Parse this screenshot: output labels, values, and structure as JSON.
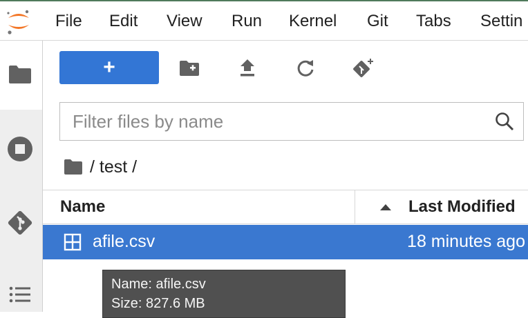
{
  "menubar": {
    "items": [
      "File",
      "Edit",
      "View",
      "Run",
      "Kernel",
      "Git",
      "Tabs",
      "Settin"
    ]
  },
  "sidebar": {
    "icons": [
      "folder-icon",
      "stop-circle-icon",
      "git-icon",
      "list-icon"
    ],
    "active": "folder-icon"
  },
  "toolbar": {
    "new_label": "+",
    "icons": [
      "new-folder-icon",
      "upload-icon",
      "refresh-icon",
      "git-clone-icon"
    ]
  },
  "filter": {
    "placeholder": "Filter files by name",
    "value": ""
  },
  "breadcrumb": {
    "text": "/ test /"
  },
  "table": {
    "columns": [
      "Name",
      "Last Modified"
    ],
    "sort_direction": "ascending",
    "rows": [
      {
        "name": "afile.csv",
        "modified": "18 minutes ago",
        "selected": true
      }
    ]
  },
  "tooltip": {
    "lines": [
      "Name: afile.csv",
      "Size: 827.6 MB"
    ]
  },
  "colors": {
    "accent": "#3376d5",
    "selection": "#3a78d0",
    "sidebar": "#eeeeee",
    "tooltip": "#505050",
    "logo_orange": "#f37626"
  }
}
